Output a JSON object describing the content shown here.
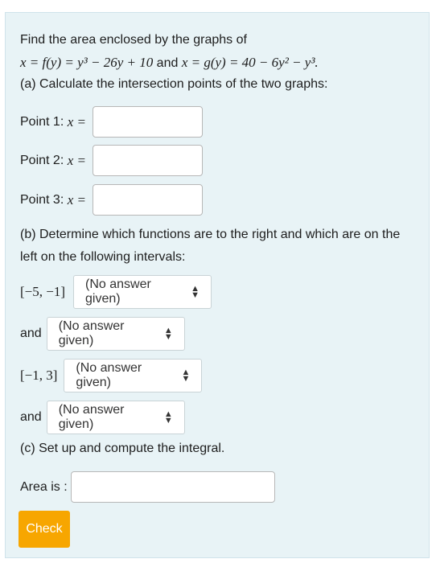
{
  "problem": {
    "line1": "Find the area enclosed by the graphs of",
    "eq_f": "x = f(y) = y³ − 26y + 10",
    "and": "and",
    "eq_g": "x = g(y) = 40 − 6y² − y³."
  },
  "part_a": {
    "prompt": "(a) Calculate the intersection points of the two graphs:",
    "points": [
      {
        "label": "Point 1: ",
        "var": "x =",
        "value": ""
      },
      {
        "label": "Point 2: ",
        "var": "x =",
        "value": ""
      },
      {
        "label": "Point 3: ",
        "var": "x =",
        "value": ""
      }
    ]
  },
  "part_b": {
    "prompt_line1": "(b) Determine which functions are to the right and which are on the",
    "prompt_line2": "left on the following intervals:",
    "interval1": "[−5, −1]",
    "interval2": "[−1, 3]",
    "and_label": "and",
    "select_value": "(No answer given)"
  },
  "part_c": {
    "prompt": "(c) Set up and compute the integral.",
    "area_label": "Area is :",
    "area_value": ""
  },
  "check_button": "Check",
  "colors": {
    "card_bg": "#e8f3f6",
    "check_button": "#f7a600"
  }
}
